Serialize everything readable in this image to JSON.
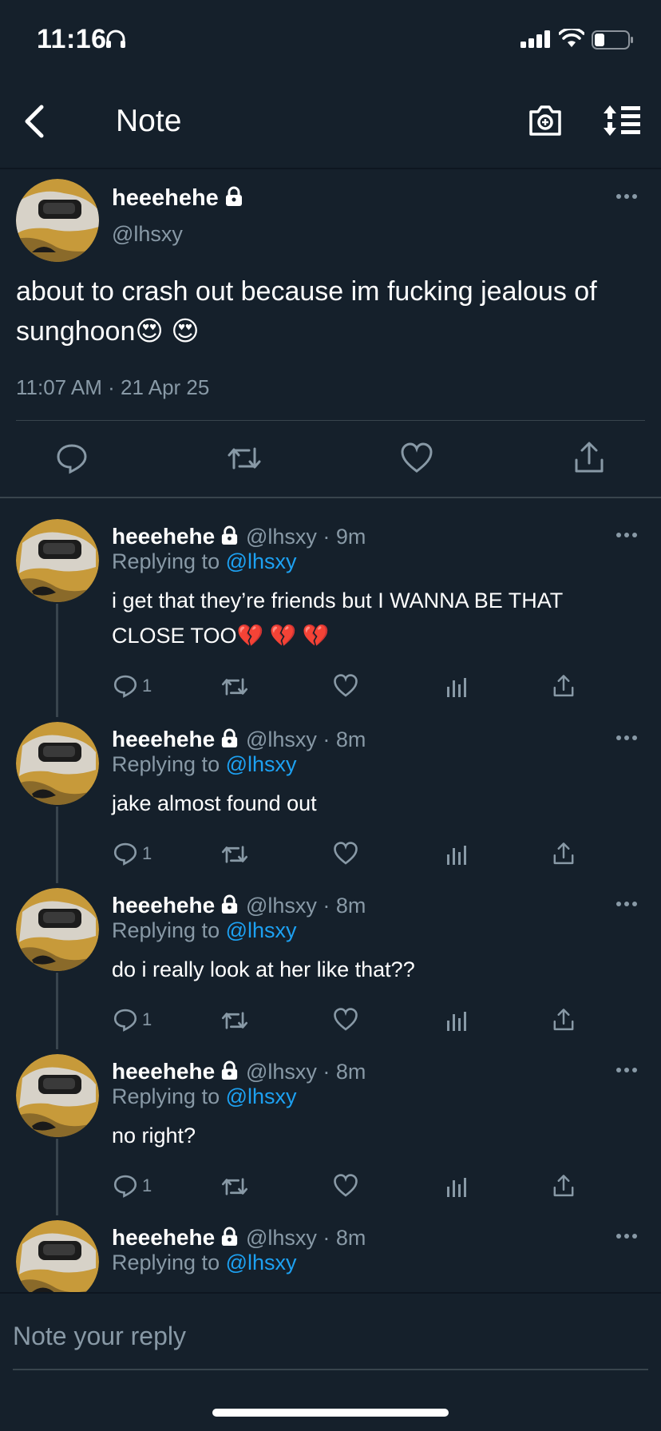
{
  "status_bar": {
    "time": "11:16"
  },
  "nav": {
    "title": "Note"
  },
  "main_tweet": {
    "name": "heeehehe",
    "handle": "@lhsxy",
    "text": "about to crash out because im fucking jealous of sunghoon😍 😍",
    "timestamp": "11:07 AM · 21 Apr 25"
  },
  "replies": [
    {
      "name": "heeehehe",
      "meta": "@lhsxy · 9m",
      "replying_prefix": "Replying to ",
      "replying_handle": "@lhsxy",
      "text": "i get that they’re friends but I WANNA BE THAT CLOSE TOO💔 💔 💔",
      "reply_count": "1"
    },
    {
      "name": "heeehehe",
      "meta": "@lhsxy · 8m",
      "replying_prefix": "Replying to ",
      "replying_handle": "@lhsxy",
      "text": "jake almost found out",
      "reply_count": "1"
    },
    {
      "name": "heeehehe",
      "meta": "@lhsxy · 8m",
      "replying_prefix": "Replying to ",
      "replying_handle": "@lhsxy",
      "text": "do i really look at her like that??",
      "reply_count": "1"
    },
    {
      "name": "heeehehe",
      "meta": "@lhsxy · 8m",
      "replying_prefix": "Replying to ",
      "replying_handle": "@lhsxy",
      "text": "no right?",
      "reply_count": "1"
    },
    {
      "name": "heeehehe",
      "meta": "@lhsxy · 8m",
      "replying_prefix": "Replying to ",
      "replying_handle": "@lhsxy",
      "text": "",
      "reply_count": ""
    }
  ],
  "reply_box": {
    "placeholder": "Note your reply"
  },
  "colors": {
    "background": "#15202b",
    "accent": "#1da1f2",
    "muted": "#8899a6",
    "divider": "#38444d"
  },
  "icons": [
    "headphones-icon",
    "signal-icon",
    "wifi-icon",
    "battery-icon",
    "back-icon",
    "camera-icon",
    "sort-icon",
    "lock-icon",
    "more-icon",
    "reply-icon",
    "retweet-icon",
    "like-icon",
    "analytics-icon",
    "share-icon"
  ]
}
